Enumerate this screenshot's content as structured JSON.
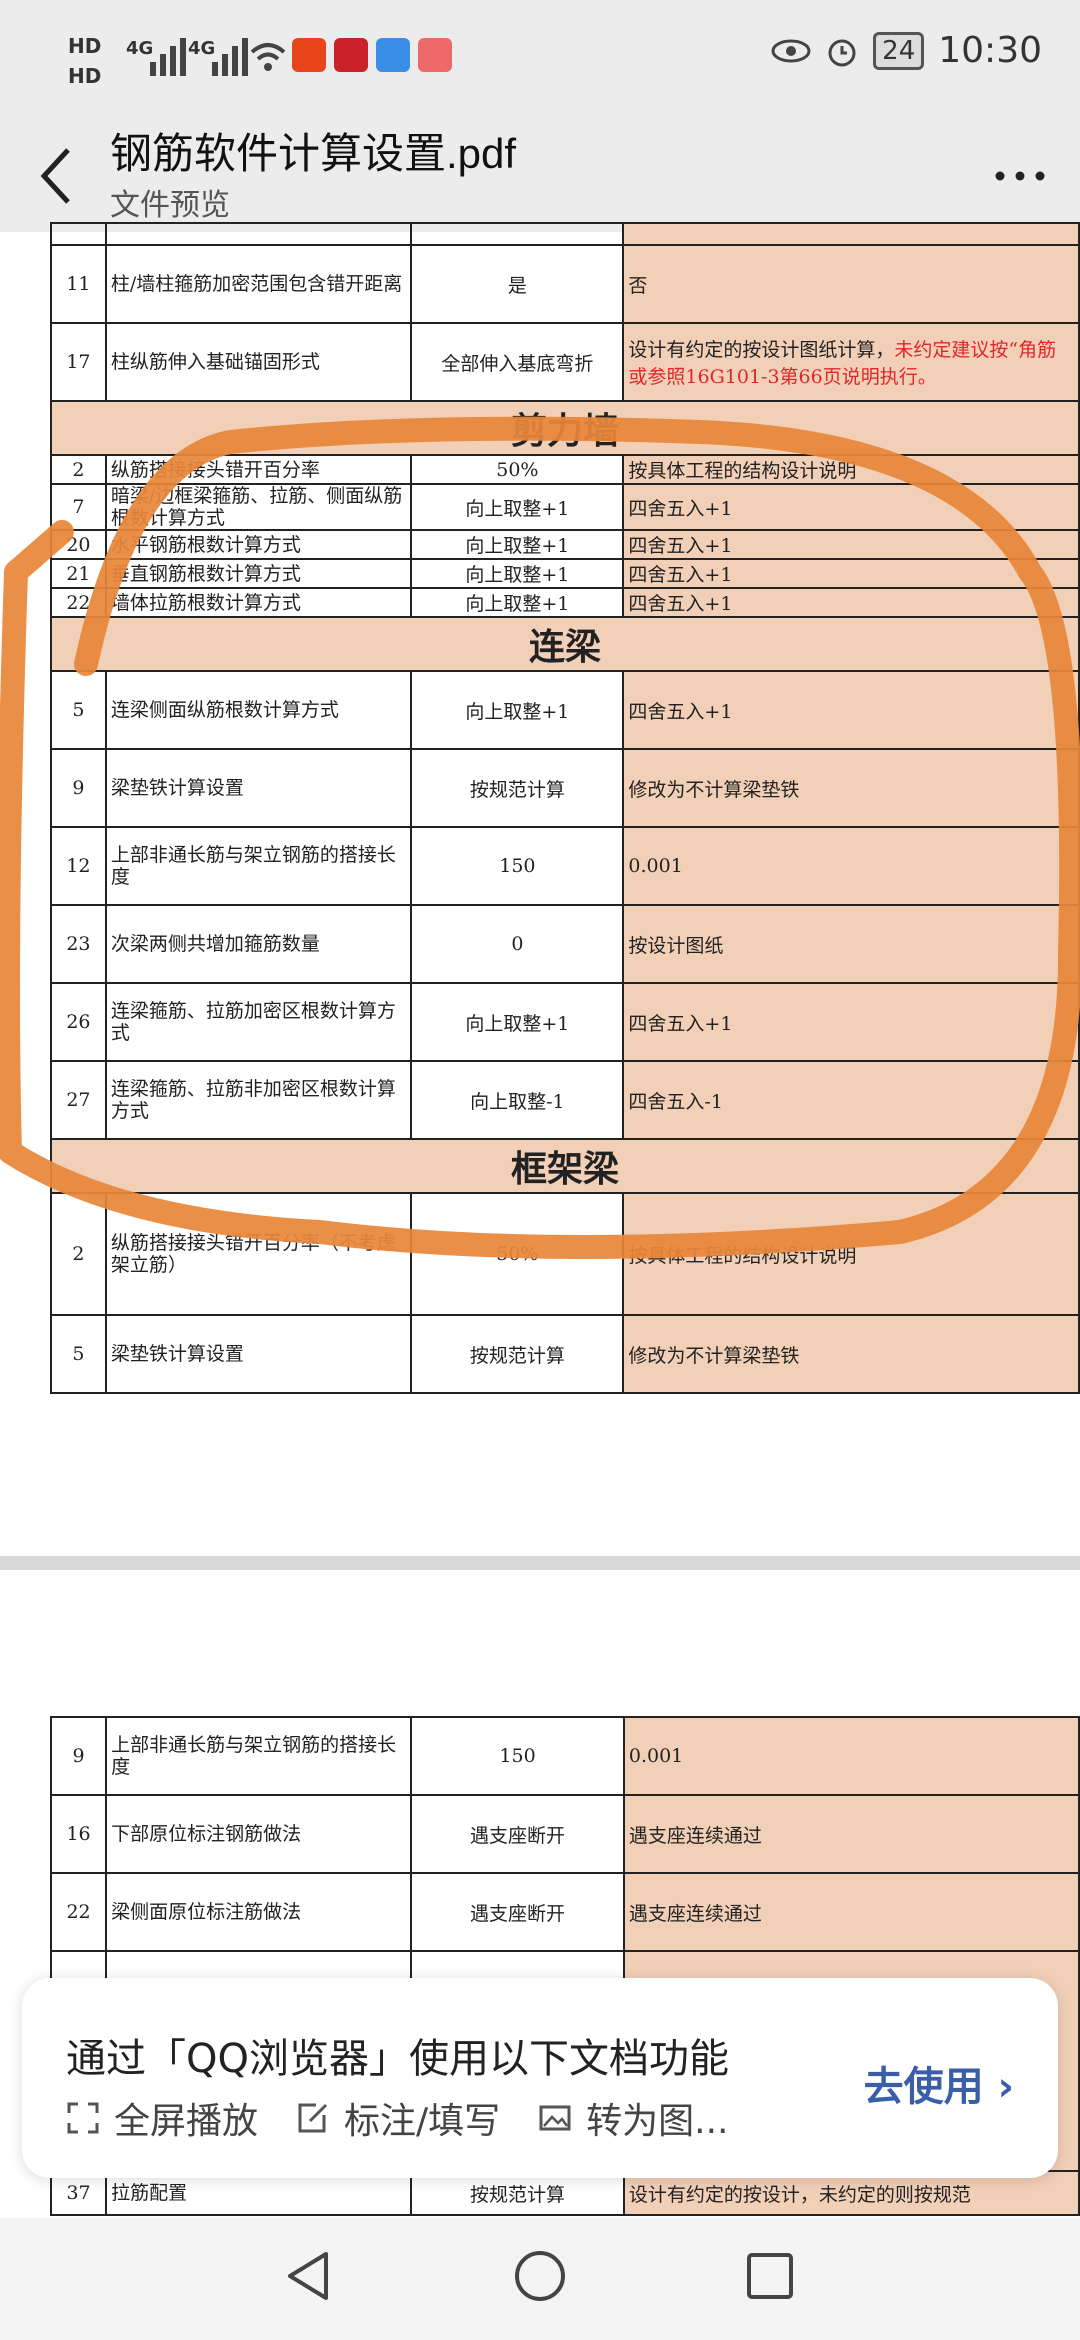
{
  "statusbar": {
    "hd1": "HD",
    "hd2": "HD",
    "net1": "4G",
    "net2": "4G",
    "battery": "24",
    "time": "10:30"
  },
  "header": {
    "title": "钢筋软件计算设置.pdf",
    "subtitle": "文件预览"
  },
  "page1": {
    "rows_top": [
      {
        "no": "11",
        "name": "柱/墙柱箍筋加密范围包含错开距离",
        "def": "是",
        "rec": "否"
      },
      {
        "no": "17",
        "name": "柱纵筋伸入基础锚固形式",
        "def": "全部伸入基底弯折",
        "rec_a": "设计有约定的按设计图纸计算，",
        "rec_b": "未约定建议按“角筋",
        "rec_c": "或参照16G101-3第66页说明执行。"
      }
    ],
    "section_shear_wall": "剪力墙",
    "rows_wall": [
      {
        "no": "2",
        "name": "纵筋搭接接头错开百分率",
        "def": "50%",
        "rec": "按具体工程的结构设计说明"
      },
      {
        "no": "7",
        "name": "暗梁/边框梁箍筋、拉筋、侧面纵筋根数计算方式",
        "def": "向上取整+1",
        "rec": "四舍五入+1"
      },
      {
        "no": "20",
        "name": "水平钢筋根数计算方式",
        "def": "向上取整+1",
        "rec": "四舍五入+1"
      },
      {
        "no": "21",
        "name": "垂直钢筋根数计算方式",
        "def": "向上取整+1",
        "rec": "四舍五入+1"
      },
      {
        "no": "22",
        "name": "墙体拉筋根数计算方式",
        "def": "向上取整+1",
        "rec": "四舍五入+1"
      }
    ],
    "section_coupling_beam": "连梁",
    "rows_beam": [
      {
        "no": "5",
        "name": "连梁侧面纵筋根数计算方式",
        "def": "向上取整+1",
        "rec": "四舍五入+1"
      },
      {
        "no": "9",
        "name": "梁垫铁计算设置",
        "def": "按规范计算",
        "rec": "修改为不计算梁垫铁"
      },
      {
        "no": "12",
        "name": "上部非通长筋与架立钢筋的搭接长度",
        "def": "150",
        "rec": "0.001"
      },
      {
        "no": "23",
        "name": "次梁两侧共增加箍筋数量",
        "def": "0",
        "rec": "按设计图纸"
      },
      {
        "no": "26",
        "name": "连梁箍筋、拉筋加密区根数计算方式",
        "def": "向上取整+1",
        "rec": "四舍五入+1"
      },
      {
        "no": "27",
        "name": "连梁箍筋、拉筋非加密区根数计算方式",
        "def": "向上取整-1",
        "rec": "四舍五入-1"
      }
    ],
    "section_frame_beam": "框架梁",
    "rows_frame": [
      {
        "no": "2",
        "name": "纵筋搭接接头错开百分率（不考虑架立筋）",
        "def": "50%",
        "rec": "按具体工程的结构设计说明"
      },
      {
        "no": "5",
        "name": "梁垫铁计算设置",
        "def": "按规范计算",
        "rec": "修改为不计算梁垫铁"
      }
    ]
  },
  "page2": {
    "rows": [
      {
        "no": "9",
        "name": "上部非通长筋与架立钢筋的搭接长度",
        "def": "150",
        "rec": "0.001"
      },
      {
        "no": "16",
        "name": "下部原位标注钢筋做法",
        "def": "遇支座断开",
        "rec": "遇支座连续通过"
      },
      {
        "no": "22",
        "name": "梁侧面原位标注筋做法",
        "def": "遇支座断开",
        "rec": "遇支座连续通过"
      },
      {
        "no": "37",
        "name": "拉筋配置",
        "def": "按规范计算",
        "rec": "设计有约定的按设计，未约定的则按规范"
      }
    ]
  },
  "banner": {
    "title": "通过「QQ浏览器」使用以下文档功能",
    "feature1": "全屏播放",
    "feature2": "标注/填写",
    "feature3": "转为图...",
    "action": "去使用"
  },
  "colors": {
    "highlight": "#f2d0b8",
    "annotation": "#e8873a",
    "link": "#3a5fa8"
  }
}
